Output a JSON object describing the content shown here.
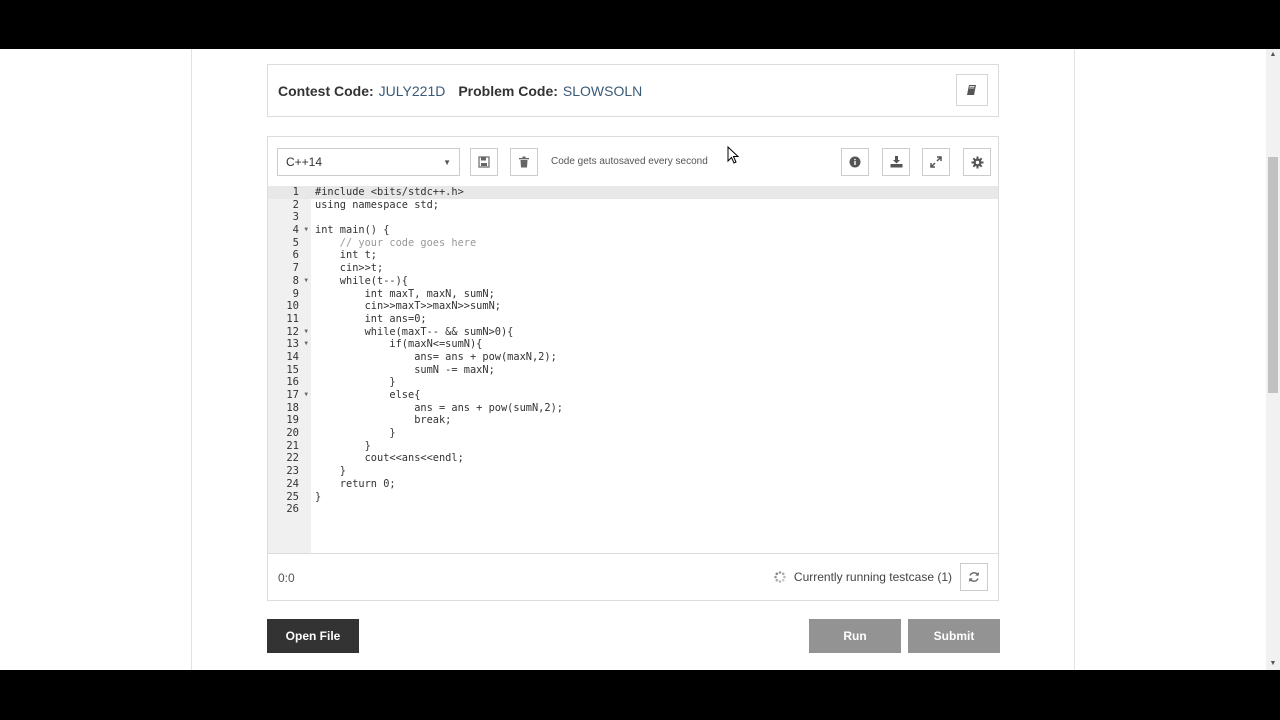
{
  "header": {
    "contest_label": "Contest Code:",
    "contest_code": "JULY221D",
    "problem_label": "Problem Code:",
    "problem_code": "SLOWSOLN",
    "book_icon": "book-icon"
  },
  "toolbar": {
    "language": "C++14",
    "autosave_text": "Code gets autosaved every second",
    "icons": [
      "save-icon",
      "trash-icon",
      "info-icon",
      "download-icon",
      "expand-icon",
      "gear-icon"
    ]
  },
  "editor": {
    "line_numbers": [
      "1",
      "2",
      "3",
      "4",
      "5",
      "6",
      "7",
      "8",
      "9",
      "10",
      "11",
      "12",
      "13",
      "14",
      "15",
      "16",
      "17",
      "18",
      "19",
      "20",
      "21",
      "22",
      "23",
      "24",
      "25",
      "26"
    ],
    "lines": [
      "#include <bits/stdc++.h>",
      "using namespace std;",
      "",
      "int main() {",
      "    // your code goes here",
      "    int t;",
      "    cin>>t;",
      "    while(t--){",
      "        int maxT, maxN, sumN;",
      "        cin>>maxT>>maxN>>sumN;",
      "        int ans=0;",
      "        while(maxT-- && sumN>0){",
      "            if(maxN<=sumN){",
      "                ans= ans + pow(maxN,2);",
      "                sumN -= maxN;",
      "            }",
      "            else{",
      "                ans = ans + pow(sumN,2);",
      "                break;",
      "            }",
      "        }",
      "        cout<<ans<<endl;",
      "    }",
      "    return 0;",
      "}",
      ""
    ]
  },
  "status": {
    "cursor": "0:0",
    "running_text": "Currently running testcase (1)"
  },
  "buttons": {
    "open_file": "Open File",
    "run": "Run",
    "submit": "Submit"
  }
}
